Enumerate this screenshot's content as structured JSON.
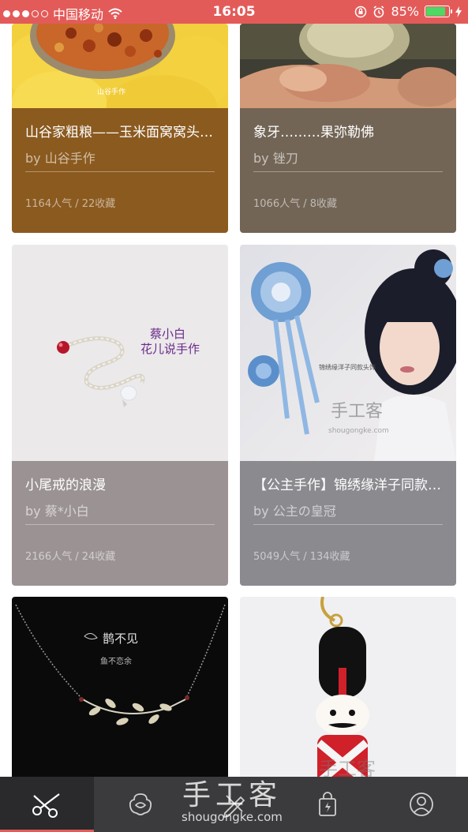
{
  "status_bar": {
    "carrier": "中国移动",
    "time": "16:05",
    "battery": "85%",
    "battery_level": 0.85
  },
  "cards": [
    {
      "title": "山谷家粗粮——玉米面窝窝头…",
      "author": "by 山谷手作",
      "stats": "1164人气 / 22收藏",
      "info_color": "#8b5a1f",
      "image_caption": "山谷手作"
    },
    {
      "title": "象牙………果弥勒佛",
      "author": "by 锉刀",
      "stats": "1066人气 / 8收藏",
      "info_color": "#726556"
    },
    {
      "title": "小尾戒的浪漫",
      "author": "by 蔡*小白",
      "stats": "2166人气 / 24收藏",
      "info_color": "#9b9393",
      "image_text": [
        "蔡小白",
        "花儿说手作"
      ]
    },
    {
      "title": "【公主手作】锦绣缘洋子同款…",
      "author": "by 公主の皇冠",
      "stats": "5049人气 / 134收藏",
      "info_color": "#8b8a8f",
      "image_text": [
        "锦绣缘洋子同款头饰",
        "手工客",
        "shougongke.com"
      ]
    },
    {
      "image_text": [
        "鹊不见",
        "鱼不恋余"
      ]
    },
    {
      "image_text": [
        "手工客"
      ]
    }
  ],
  "tab_bar": {
    "tabs": [
      {
        "icon": "scissors-icon",
        "active": true
      },
      {
        "icon": "flower-icon",
        "active": false
      },
      {
        "icon": "tools-icon",
        "active": false
      },
      {
        "icon": "shopping-bag-icon",
        "active": false
      },
      {
        "icon": "user-profile-icon",
        "active": false
      }
    ],
    "accent": "#e35b59"
  },
  "watermark": {
    "text": "手工客",
    "url": "shougongke.com"
  }
}
